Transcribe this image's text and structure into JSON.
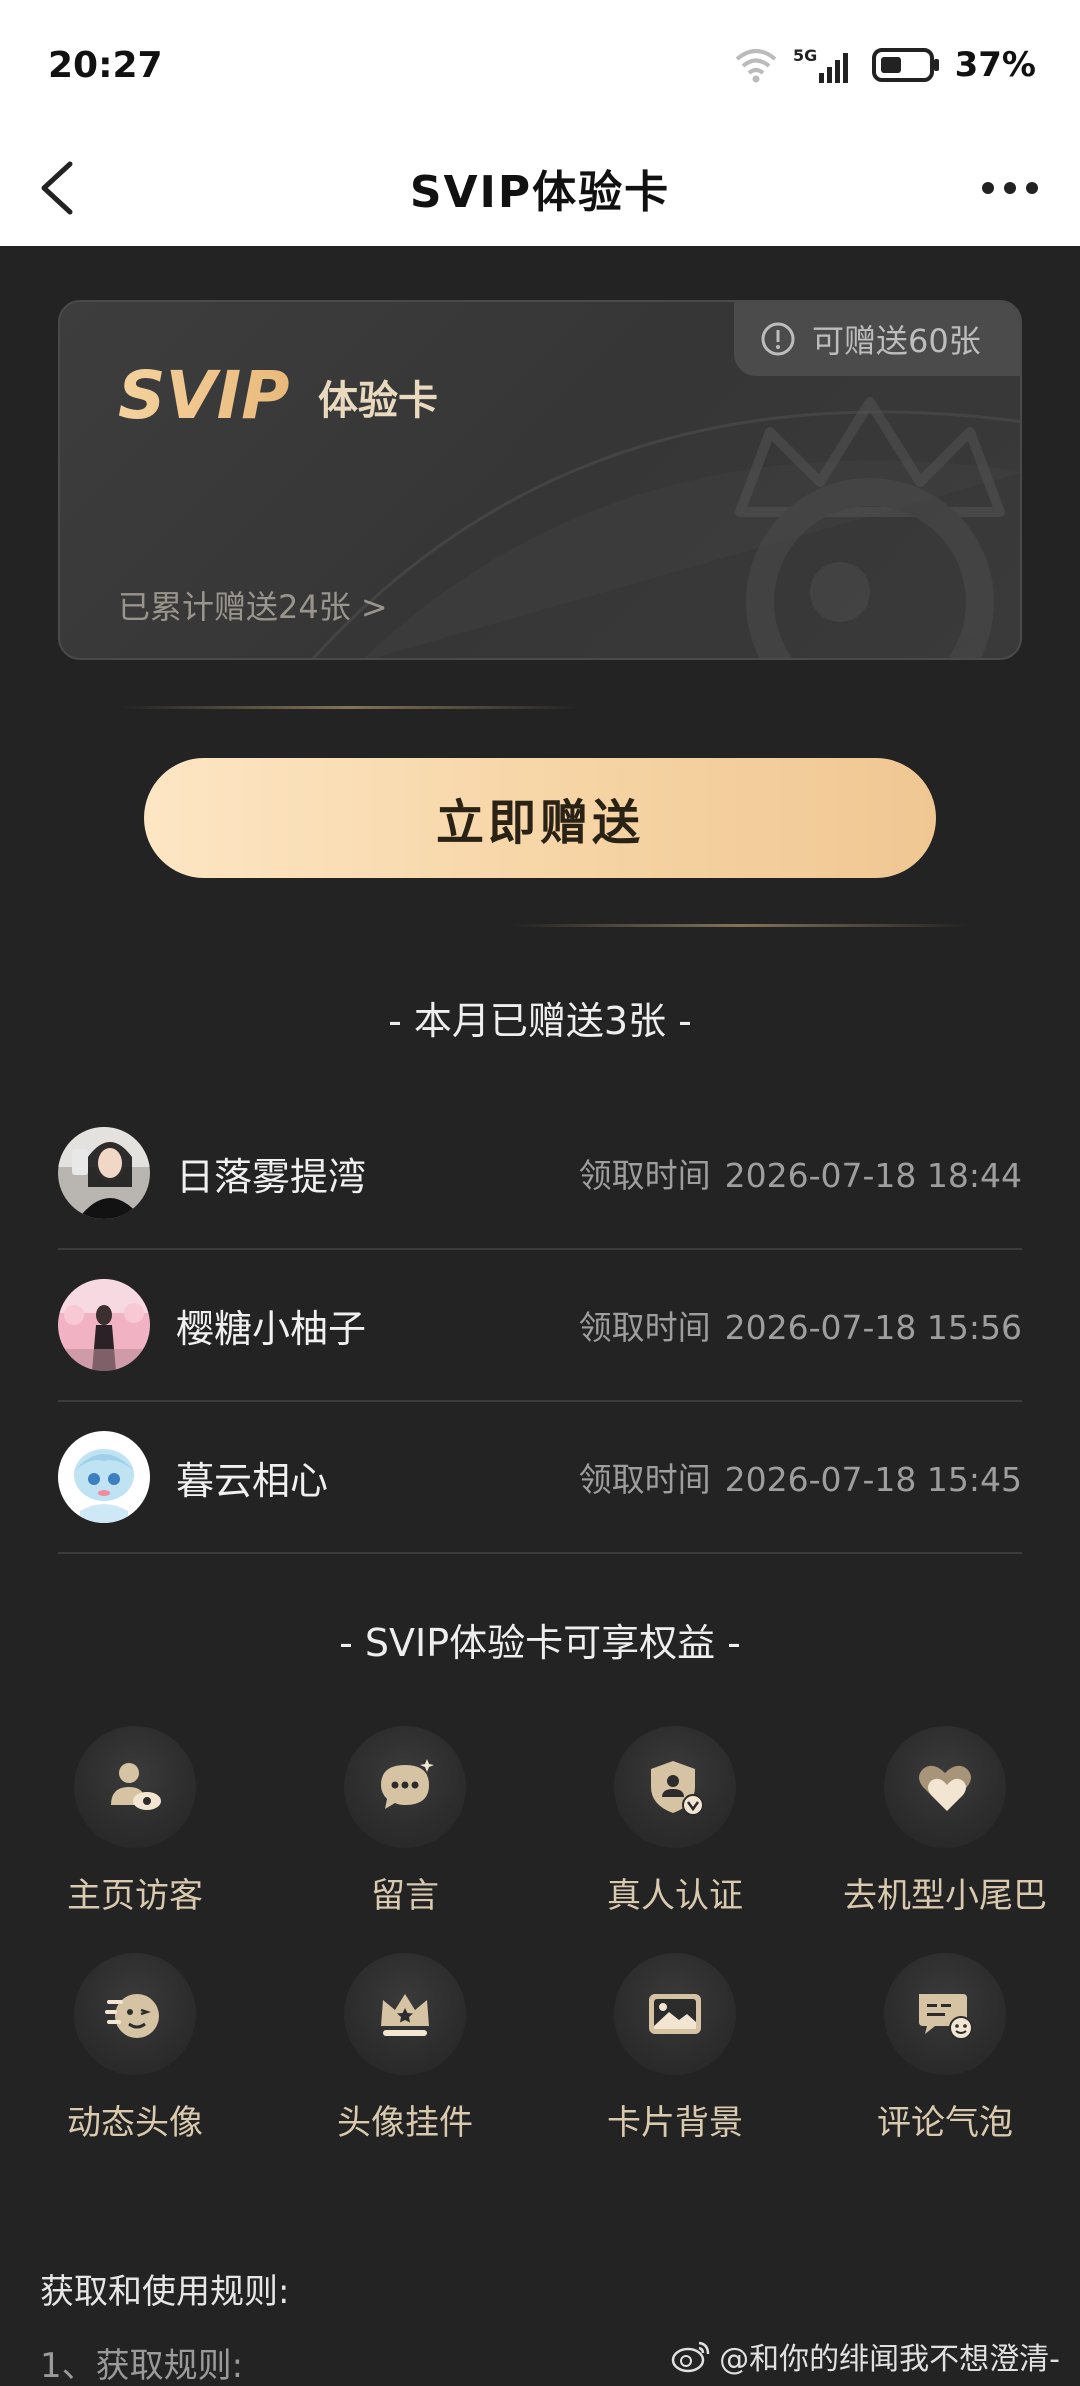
{
  "status_bar": {
    "time": "20:27",
    "network": "5G",
    "battery": "37%"
  },
  "nav": {
    "title": "SVIP体验卡"
  },
  "card": {
    "logo_text": "SVIP",
    "subtitle": "体验卡",
    "remaining_badge": "可赠送60张",
    "total_sent": "已累计赠送24张 >"
  },
  "send_button": "立即赠送",
  "month_heading": "- 本月已赠送3张 -",
  "records": [
    {
      "name": "日落雾提湾",
      "time_label": "领取时间",
      "time": "2026-07-18 18:44"
    },
    {
      "name": "樱糖小柚子",
      "time_label": "领取时间",
      "time": "2026-07-18 15:56"
    },
    {
      "name": "暮云相心",
      "time_label": "领取时间",
      "time": "2026-07-18 15:45"
    }
  ],
  "benefits_heading": "- SVIP体验卡可享权益 -",
  "benefits": [
    {
      "label": "主页访客",
      "icon": "visitor-icon"
    },
    {
      "label": "留言",
      "icon": "message-icon"
    },
    {
      "label": "真人认证",
      "icon": "verified-icon"
    },
    {
      "label": "去机型小尾巴",
      "icon": "heart-icon"
    },
    {
      "label": "动态头像",
      "icon": "animated-avatar-icon"
    },
    {
      "label": "头像挂件",
      "icon": "crown-icon"
    },
    {
      "label": "卡片背景",
      "icon": "card-background-icon"
    },
    {
      "label": "评论气泡",
      "icon": "comment-bubble-icon"
    }
  ],
  "rules": {
    "title": "获取和使用规则:",
    "item_1": "1、获取规则:"
  },
  "watermark": "@和你的绯闻我不想澄清-",
  "colors": {
    "background": "#232323",
    "gold_accent": "#f6d4a4",
    "benefit_label": "#d9c9ae"
  }
}
